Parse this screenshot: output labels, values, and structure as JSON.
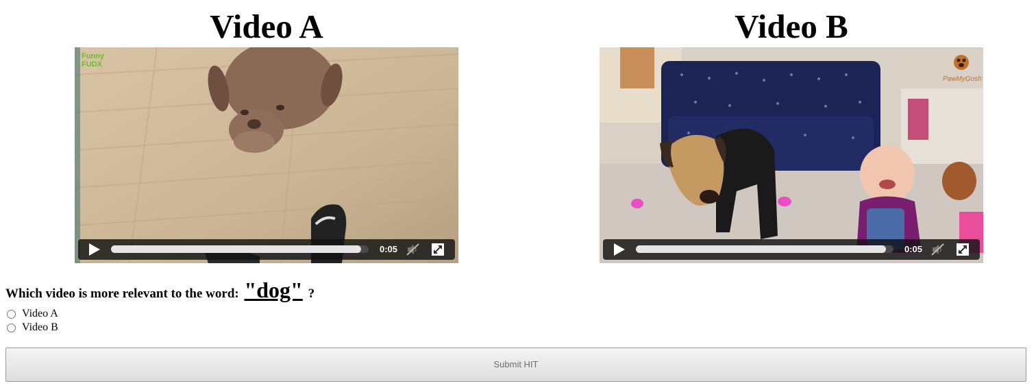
{
  "videos": [
    {
      "title": "Video A",
      "time": "0:05",
      "progress": 0.97,
      "watermark": [
        "Funny",
        "FUDX"
      ],
      "icons": {
        "play": "play-icon",
        "mute": "muted-volume-icon",
        "fullscreen": "fullscreen-icon"
      }
    },
    {
      "title": "Video B",
      "time": "0:05",
      "progress": 0.97,
      "watermark_text": "PawMyGosh",
      "icons": {
        "play": "play-icon",
        "mute": "muted-volume-icon",
        "fullscreen": "fullscreen-icon"
      }
    }
  ],
  "question": {
    "prefix": "Which video is more relevant to the word:",
    "word": "\"dog\"",
    "suffix": "?"
  },
  "options": [
    {
      "label": "Video A",
      "value": "A",
      "checked": false
    },
    {
      "label": "Video B",
      "value": "B",
      "checked": false
    }
  ],
  "submit": {
    "label": "Submit HIT",
    "enabled": false
  }
}
